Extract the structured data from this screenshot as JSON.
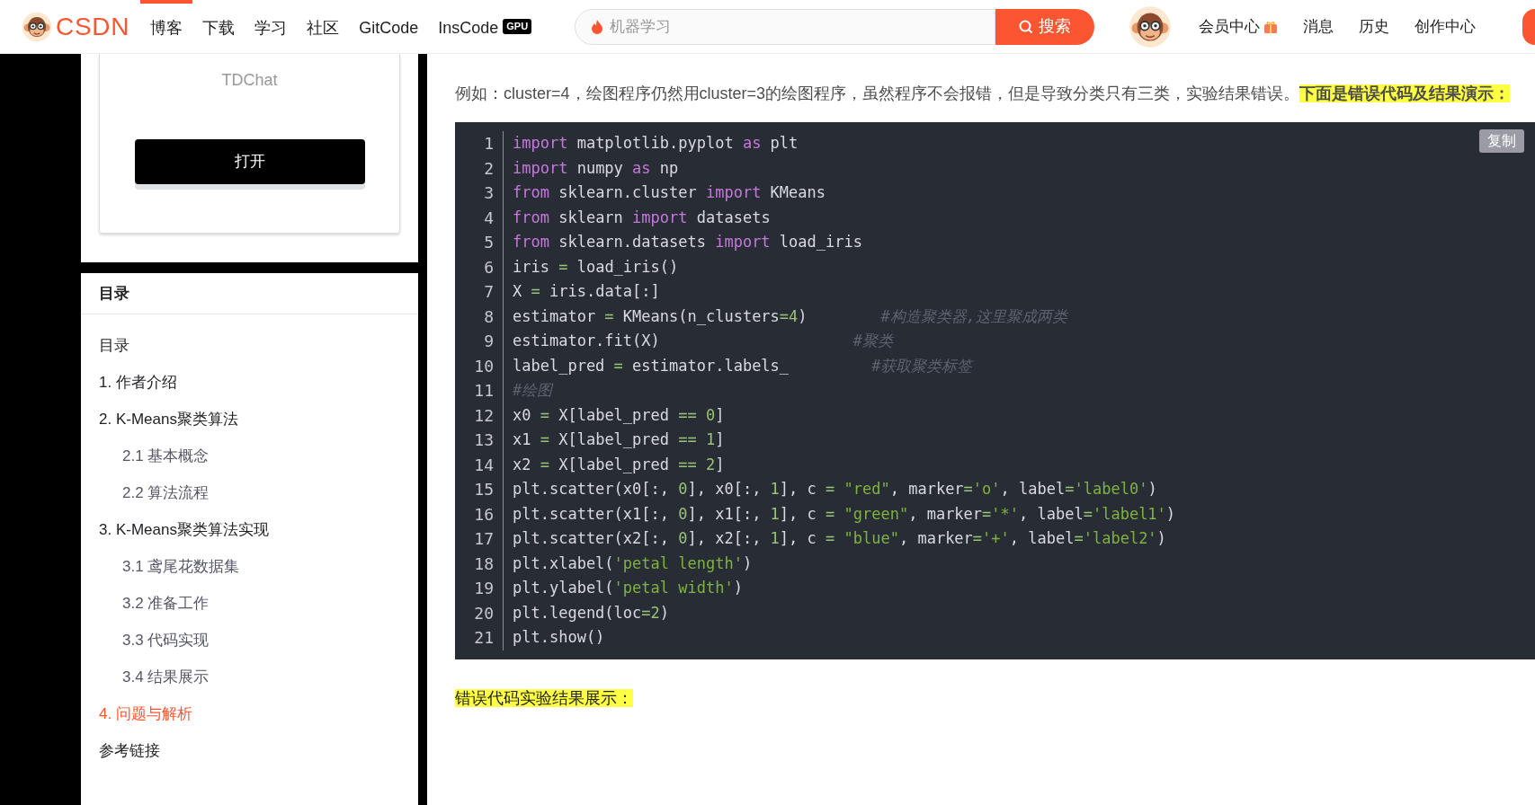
{
  "header": {
    "logo": "CSDN",
    "nav": [
      {
        "label": "博客",
        "selected": true
      },
      {
        "label": "下载",
        "selected": false
      },
      {
        "label": "学习",
        "selected": false
      },
      {
        "label": "社区",
        "selected": false
      },
      {
        "label": "GitCode",
        "selected": false
      },
      {
        "label": "InsCode",
        "selected": false
      }
    ],
    "gpu_badge": "GPU",
    "search": {
      "placeholder": "机器学习",
      "button": "搜索"
    },
    "links": [
      {
        "label": "会员中心",
        "gift": true
      },
      {
        "label": "消息",
        "gift": false
      },
      {
        "label": "历史",
        "gift": false
      },
      {
        "label": "创作中心",
        "gift": false
      }
    ]
  },
  "sidebar": {
    "card": {
      "title": "TDChat",
      "button": "打开"
    },
    "toc": {
      "title": "目录",
      "items": [
        {
          "label": "目录",
          "selected": false
        },
        {
          "label": "1. 作者介绍",
          "selected": false
        },
        {
          "label": "2. K-Means聚类算法",
          "selected": false,
          "children": [
            {
              "label": "2.1 基本概念",
              "selected": false
            },
            {
              "label": "2.2 算法流程",
              "selected": false
            }
          ]
        },
        {
          "label": "3. K-Means聚类算法实现",
          "selected": false,
          "children": [
            {
              "label": "3.1 鸢尾花数据集",
              "selected": false
            },
            {
              "label": "3.2 准备工作",
              "selected": false
            },
            {
              "label": "3.3 代码实现",
              "selected": false
            },
            {
              "label": "3.4 结果展示",
              "selected": false
            }
          ]
        },
        {
          "label": "4. 问题与解析",
          "selected": true
        },
        {
          "label": "参考链接",
          "selected": false
        }
      ]
    }
  },
  "article": {
    "paragraph": [
      {
        "text": "例如：cluster=4，绘图程序仍然用cluster=3的绘图程序，虽然程序不会报错，但是导致分类只有三类，实验结果错误。",
        "highlighted": false
      },
      {
        "text": "**下面是错误代码及结果演示：**",
        "highlighted": true
      }
    ],
    "code": {
      "copy_button": "复制",
      "lines": [
        {
          "no": "1",
          "tokens": [
            {
              "kind": "keyword",
              "text": "import"
            },
            {
              "kind": "plain",
              "text": " matplotlib.pyplot "
            },
            {
              "kind": "keyword",
              "text": "as"
            },
            {
              "kind": "plain",
              "text": " plt"
            }
          ]
        },
        {
          "no": "2",
          "tokens": [
            {
              "kind": "keyword",
              "text": "import"
            },
            {
              "kind": "plain",
              "text": " numpy "
            },
            {
              "kind": "keyword",
              "text": "as"
            },
            {
              "kind": "plain",
              "text": " np"
            }
          ]
        },
        {
          "no": "3",
          "tokens": [
            {
              "kind": "keyword",
              "text": "from"
            },
            {
              "kind": "plain",
              "text": " sklearn.cluster "
            },
            {
              "kind": "keyword",
              "text": "import"
            },
            {
              "kind": "plain",
              "text": " KMeans"
            }
          ]
        },
        {
          "no": "4",
          "tokens": [
            {
              "kind": "keyword",
              "text": "from"
            },
            {
              "kind": "plain",
              "text": " sklearn "
            },
            {
              "kind": "keyword",
              "text": "import"
            },
            {
              "kind": "plain",
              "text": " datasets"
            }
          ]
        },
        {
          "no": "5",
          "tokens": [
            {
              "kind": "keyword",
              "text": "from"
            },
            {
              "kind": "plain",
              "text": " sklearn.datasets "
            },
            {
              "kind": "keyword",
              "text": "import"
            },
            {
              "kind": "plain",
              "text": " load_iris"
            }
          ]
        },
        {
          "no": "6",
          "tokens": [
            {
              "kind": "plain",
              "text": "iris "
            },
            {
              "kind": "operator",
              "text": "="
            },
            {
              "kind": "plain",
              "text": " load_iris()"
            }
          ]
        },
        {
          "no": "7",
          "tokens": [
            {
              "kind": "plain",
              "text": "X "
            },
            {
              "kind": "operator",
              "text": "="
            },
            {
              "kind": "plain",
              "text": " iris.data[:]"
            }
          ]
        },
        {
          "no": "8",
          "tokens": [
            {
              "kind": "plain",
              "text": "estimator "
            },
            {
              "kind": "operator",
              "text": "="
            },
            {
              "kind": "plain",
              "text": " KMeans(n_clusters"
            },
            {
              "kind": "operator",
              "text": "="
            },
            {
              "kind": "number",
              "text": "4"
            },
            {
              "kind": "plain",
              "text": ")        "
            },
            {
              "kind": "comment",
              "text": "#构造聚类器,这里聚成两类"
            }
          ]
        },
        {
          "no": "9",
          "tokens": [
            {
              "kind": "plain",
              "text": "estimator.fit(X)                     "
            },
            {
              "kind": "comment",
              "text": "#聚类"
            }
          ]
        },
        {
          "no": "10",
          "tokens": [
            {
              "kind": "plain",
              "text": "label_pred "
            },
            {
              "kind": "operator",
              "text": "="
            },
            {
              "kind": "plain",
              "text": " estimator.labels_         "
            },
            {
              "kind": "comment",
              "text": "#获取聚类标签"
            }
          ]
        },
        {
          "no": "11",
          "tokens": [
            {
              "kind": "comment",
              "text": "#绘图"
            }
          ]
        },
        {
          "no": "12",
          "tokens": [
            {
              "kind": "plain",
              "text": "x0 "
            },
            {
              "kind": "operator",
              "text": "="
            },
            {
              "kind": "plain",
              "text": " X[label_pred "
            },
            {
              "kind": "operator",
              "text": "== "
            },
            {
              "kind": "number",
              "text": "0"
            },
            {
              "kind": "plain",
              "text": "]"
            }
          ]
        },
        {
          "no": "13",
          "tokens": [
            {
              "kind": "plain",
              "text": "x1 "
            },
            {
              "kind": "operator",
              "text": "="
            },
            {
              "kind": "plain",
              "text": " X[label_pred "
            },
            {
              "kind": "operator",
              "text": "== "
            },
            {
              "kind": "number",
              "text": "1"
            },
            {
              "kind": "plain",
              "text": "]"
            }
          ]
        },
        {
          "no": "14",
          "tokens": [
            {
              "kind": "plain",
              "text": "x2 "
            },
            {
              "kind": "operator",
              "text": "="
            },
            {
              "kind": "plain",
              "text": " X[label_pred "
            },
            {
              "kind": "operator",
              "text": "== "
            },
            {
              "kind": "number",
              "text": "2"
            },
            {
              "kind": "plain",
              "text": "]"
            }
          ]
        },
        {
          "no": "15",
          "tokens": [
            {
              "kind": "plain",
              "text": "plt.scatter(x0[:, "
            },
            {
              "kind": "number",
              "text": "0"
            },
            {
              "kind": "plain",
              "text": "], x0[:, "
            },
            {
              "kind": "number",
              "text": "1"
            },
            {
              "kind": "plain",
              "text": "], c "
            },
            {
              "kind": "operator",
              "text": "= "
            },
            {
              "kind": "string",
              "text": "\"red\""
            },
            {
              "kind": "plain",
              "text": ", marker"
            },
            {
              "kind": "operator",
              "text": "="
            },
            {
              "kind": "string",
              "text": "'o'"
            },
            {
              "kind": "plain",
              "text": ", label"
            },
            {
              "kind": "operator",
              "text": "="
            },
            {
              "kind": "string",
              "text": "'label0'"
            },
            {
              "kind": "plain",
              "text": ")"
            }
          ]
        },
        {
          "no": "16",
          "tokens": [
            {
              "kind": "plain",
              "text": "plt.scatter(x1[:, "
            },
            {
              "kind": "number",
              "text": "0"
            },
            {
              "kind": "plain",
              "text": "], x1[:, "
            },
            {
              "kind": "number",
              "text": "1"
            },
            {
              "kind": "plain",
              "text": "], c "
            },
            {
              "kind": "operator",
              "text": "= "
            },
            {
              "kind": "string",
              "text": "\"green\""
            },
            {
              "kind": "plain",
              "text": ", marker"
            },
            {
              "kind": "operator",
              "text": "="
            },
            {
              "kind": "string",
              "text": "'*'"
            },
            {
              "kind": "plain",
              "text": ", label"
            },
            {
              "kind": "operator",
              "text": "="
            },
            {
              "kind": "string",
              "text": "'label1'"
            },
            {
              "kind": "plain",
              "text": ")"
            }
          ]
        },
        {
          "no": "17",
          "tokens": [
            {
              "kind": "plain",
              "text": "plt.scatter(x2[:, "
            },
            {
              "kind": "number",
              "text": "0"
            },
            {
              "kind": "plain",
              "text": "], x2[:, "
            },
            {
              "kind": "number",
              "text": "1"
            },
            {
              "kind": "plain",
              "text": "], c "
            },
            {
              "kind": "operator",
              "text": "= "
            },
            {
              "kind": "string",
              "text": "\"blue\""
            },
            {
              "kind": "plain",
              "text": ", marker"
            },
            {
              "kind": "operator",
              "text": "="
            },
            {
              "kind": "string",
              "text": "'+'"
            },
            {
              "kind": "plain",
              "text": ", label"
            },
            {
              "kind": "operator",
              "text": "="
            },
            {
              "kind": "string",
              "text": "'label2'"
            },
            {
              "kind": "plain",
              "text": ")"
            }
          ]
        },
        {
          "no": "18",
          "tokens": [
            {
              "kind": "plain",
              "text": "plt.xlabel("
            },
            {
              "kind": "string",
              "text": "'petal length'"
            },
            {
              "kind": "plain",
              "text": ")"
            }
          ]
        },
        {
          "no": "19",
          "tokens": [
            {
              "kind": "plain",
              "text": "plt.ylabel("
            },
            {
              "kind": "string",
              "text": "'petal width'"
            },
            {
              "kind": "plain",
              "text": ")"
            }
          ]
        },
        {
          "no": "20",
          "tokens": [
            {
              "kind": "plain",
              "text": "plt.legend(loc"
            },
            {
              "kind": "operator",
              "text": "="
            },
            {
              "kind": "number",
              "text": "2"
            },
            {
              "kind": "plain",
              "text": ")"
            }
          ]
        },
        {
          "no": "21",
          "tokens": [
            {
              "kind": "plain",
              "text": "plt.show()"
            }
          ]
        }
      ]
    },
    "result_heading": {
      "text": "错误代码实验结果展示：",
      "highlighted": true
    }
  }
}
